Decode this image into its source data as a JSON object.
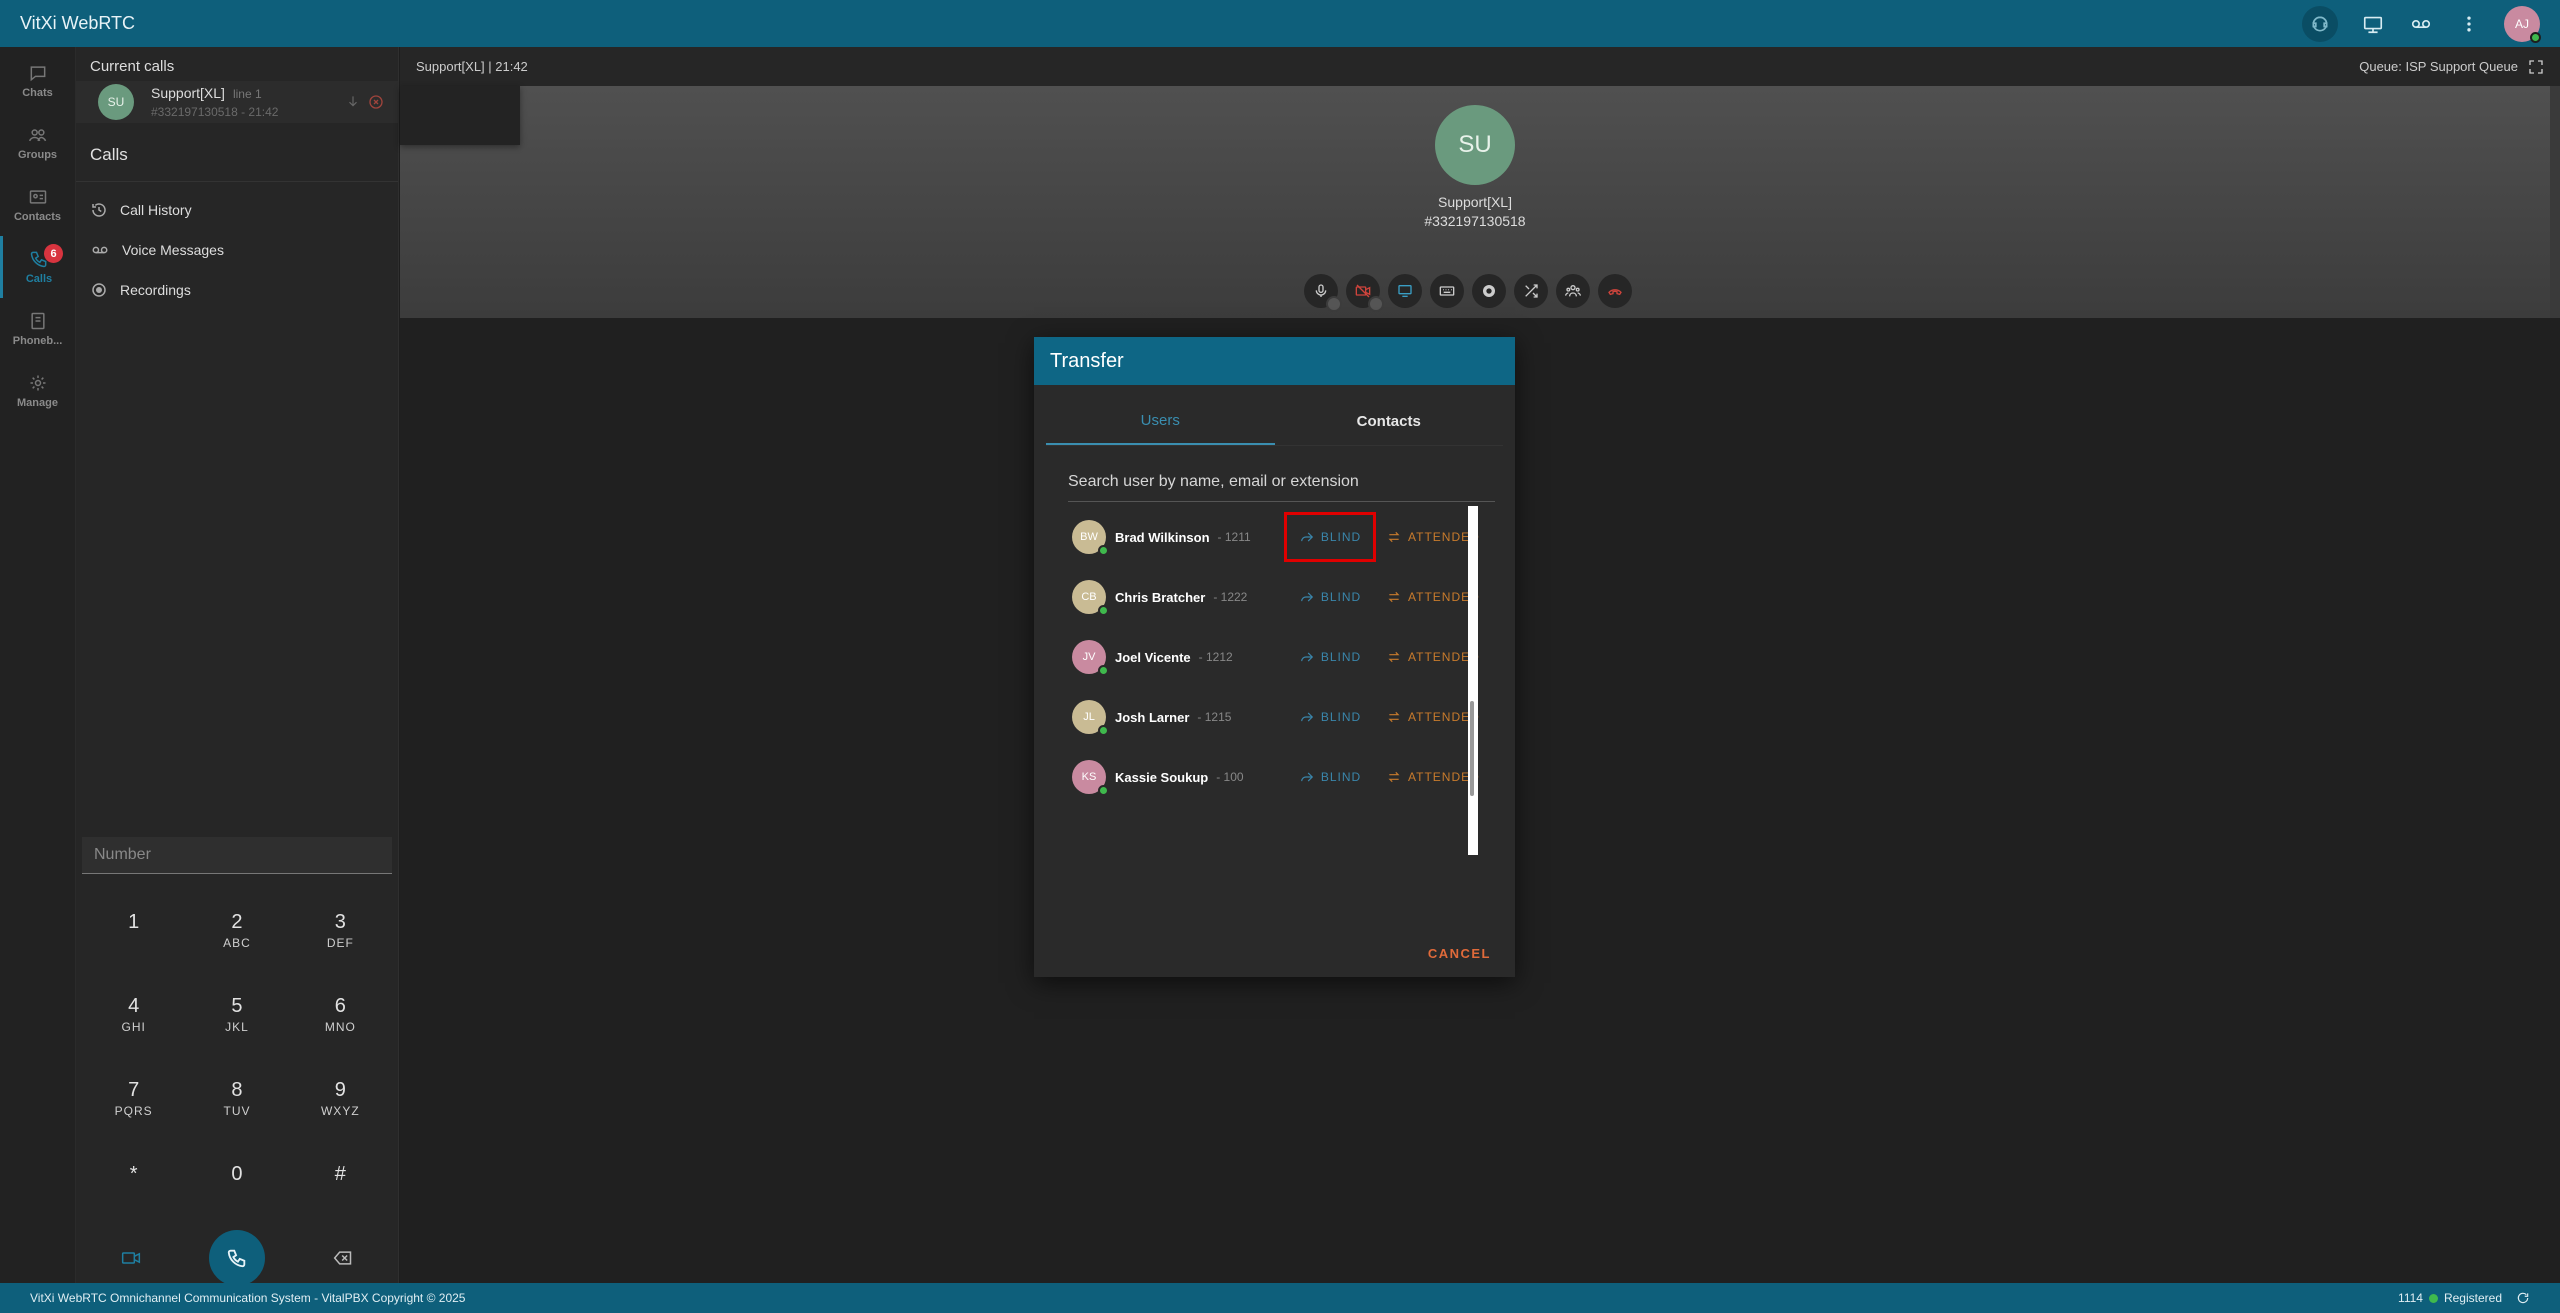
{
  "app": {
    "title": "VitXi WebRTC"
  },
  "topbar": {
    "avatar_initials": "AJ"
  },
  "rail": {
    "items": [
      {
        "label": "Chats",
        "icon": "chat-icon"
      },
      {
        "label": "Groups",
        "icon": "groups-icon"
      },
      {
        "label": "Contacts",
        "icon": "contacts-icon"
      },
      {
        "label": "Calls",
        "icon": "phone-icon",
        "badge": "6",
        "active": true
      },
      {
        "label": "Phoneb...",
        "icon": "phonebook-icon"
      },
      {
        "label": "Manage",
        "icon": "manage-icon"
      }
    ]
  },
  "sidebar": {
    "current_calls_label": "Current calls",
    "current_call": {
      "initials": "SU",
      "name": "Support[XL]",
      "line": "line 1",
      "meta": "#332197130518 - 21:42"
    },
    "calls_header": "Calls",
    "menu": [
      {
        "label": "Call History",
        "icon": "history-icon"
      },
      {
        "label": "Voice Messages",
        "icon": "voicemail-icon"
      },
      {
        "label": "Recordings",
        "icon": "record-icon"
      }
    ],
    "dialpad": {
      "placeholder": "Number",
      "keys": [
        {
          "digit": "1",
          "letters": ""
        },
        {
          "digit": "2",
          "letters": "ABC"
        },
        {
          "digit": "3",
          "letters": "DEF"
        },
        {
          "digit": "4",
          "letters": "GHI"
        },
        {
          "digit": "5",
          "letters": "JKL"
        },
        {
          "digit": "6",
          "letters": "MNO"
        },
        {
          "digit": "7",
          "letters": "PQRS"
        },
        {
          "digit": "8",
          "letters": "TUV"
        },
        {
          "digit": "9",
          "letters": "WXYZ"
        },
        {
          "digit": "*",
          "letters": ""
        },
        {
          "digit": "0",
          "letters": ""
        },
        {
          "digit": "#",
          "letters": ""
        }
      ]
    }
  },
  "main": {
    "call_label": "Support[XL] | 21:42",
    "queue_label": "Queue: ISP Support Queue",
    "peer": {
      "initials": "SU",
      "name": "Support[XL]",
      "number": "#332197130518"
    }
  },
  "transfer": {
    "title": "Transfer",
    "tabs": [
      {
        "label": "Users",
        "active": true
      },
      {
        "label": "Contacts",
        "active": false
      }
    ],
    "search_placeholder": "Search user by name, email or extension",
    "blind_label": "BLIND",
    "attended_label": "ATTENDED",
    "users": [
      {
        "initials": "BW",
        "name": "Brad Wilkinson",
        "ext": "- 1211",
        "color": "#c9bb94",
        "highlight": true
      },
      {
        "initials": "CB",
        "name": "Chris Bratcher",
        "ext": "- 1222",
        "color": "#c9bb94",
        "highlight": false
      },
      {
        "initials": "JV",
        "name": "Joel Vicente",
        "ext": "- 1212",
        "color": "#c98aa0",
        "highlight": false
      },
      {
        "initials": "JL",
        "name": "Josh Larner",
        "ext": "- 1215",
        "color": "#c9bb94",
        "highlight": false
      },
      {
        "initials": "KS",
        "name": "Kassie Soukup",
        "ext": "- 100",
        "color": "#c98aa0",
        "highlight": false
      }
    ],
    "cancel_label": "CANCEL"
  },
  "footer": {
    "copyright": "VitXi WebRTC Omnichannel Communication System - VitalPBX Copyright © 2025",
    "extension": "1114",
    "status": "Registered"
  },
  "colors": {
    "brand": "#0e5f7b",
    "blind": "#3a86ab",
    "attended": "#c87b2c",
    "cancel": "#e06a3a",
    "online": "#3fb94d",
    "highlight": "#e00000"
  }
}
